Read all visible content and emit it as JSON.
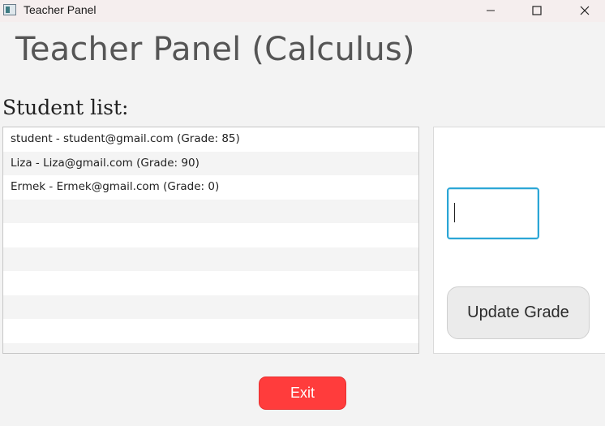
{
  "window": {
    "title": "Teacher Panel",
    "minimize_icon": "minimize-icon",
    "maximize_icon": "maximize-icon",
    "close_icon": "close-icon"
  },
  "header": {
    "title": "Teacher Panel (Calculus)"
  },
  "student_list": {
    "label": "Student list:",
    "items": [
      "student - student@gmail.com (Grade: 85)",
      "Liza - Liza@gmail.com (Grade: 90)",
      "Ermek - Ermek@gmail.com (Grade: 0)",
      "",
      "",
      "",
      "",
      "",
      "",
      ""
    ]
  },
  "grade_form": {
    "input_value": "",
    "update_label": "Update Grade"
  },
  "footer": {
    "exit_label": "Exit"
  },
  "colors": {
    "accent_focus": "#2ba6d6",
    "exit_red": "#ff3c3c"
  }
}
